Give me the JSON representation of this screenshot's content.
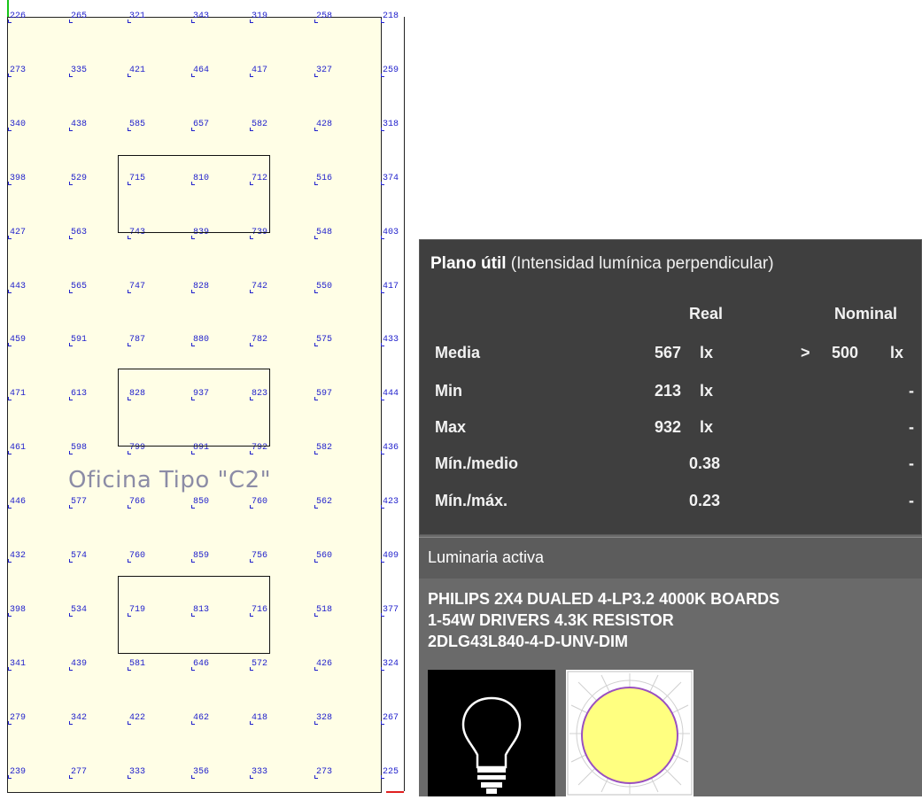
{
  "room": {
    "title": "Oficina Tipo \"C2\"",
    "grid": [
      [
        "226",
        "265",
        "321",
        "343",
        "319",
        "258",
        "218"
      ],
      [
        "273",
        "335",
        "421",
        "464",
        "417",
        "327",
        "259"
      ],
      [
        "340",
        "438",
        "585",
        "657",
        "582",
        "428",
        "318"
      ],
      [
        "398",
        "529",
        "715",
        "810",
        "712",
        "516",
        "374"
      ],
      [
        "427",
        "563",
        "743",
        "839",
        "739",
        "548",
        "403"
      ],
      [
        "443",
        "565",
        "747",
        "828",
        "742",
        "550",
        "417"
      ],
      [
        "459",
        "591",
        "787",
        "880",
        "782",
        "575",
        "433"
      ],
      [
        "471",
        "613",
        "828",
        "937",
        "823",
        "597",
        "444"
      ],
      [
        "461",
        "598",
        "799",
        "891",
        "792",
        "582",
        "436"
      ],
      [
        "446",
        "577",
        "766",
        "850",
        "760",
        "562",
        "423"
      ],
      [
        "432",
        "574",
        "760",
        "859",
        "756",
        "560",
        "409"
      ],
      [
        "398",
        "534",
        "719",
        "813",
        "716",
        "518",
        "377"
      ],
      [
        "341",
        "439",
        "581",
        "646",
        "572",
        "426",
        "324"
      ],
      [
        "279",
        "342",
        "422",
        "462",
        "418",
        "328",
        "267"
      ],
      [
        "239",
        "277",
        "333",
        "356",
        "333",
        "273",
        "225"
      ]
    ]
  },
  "results": {
    "title_bold": "Plano útil",
    "title_sub": "(Intensidad lumínica perpendicular)",
    "col_real": "Real",
    "col_nominal": "Nominal",
    "rows": [
      {
        "label": "Media",
        "real": "567",
        "real_unit": "lx",
        "cmp": ">",
        "nominal": "500",
        "nominal_unit": "lx"
      },
      {
        "label": "Min",
        "real": "213",
        "real_unit": "lx",
        "nominal": "-"
      },
      {
        "label": "Max",
        "real": "932",
        "real_unit": "lx",
        "nominal": "-"
      },
      {
        "label": "Mín./medio",
        "real": "0.38",
        "nominal": "-"
      },
      {
        "label": "Mín./máx.",
        "real": "0.23",
        "nominal": "-"
      }
    ]
  },
  "luminaire": {
    "section_label": "Luminaria activa",
    "name_lines": [
      "PHILIPS 2X4 DUALED 4-LP3.2 4000K BOARDS",
      "1-54W DRIVERS 4.3K RESISTOR",
      "2DLG43L840-4-D-UNV-DIM"
    ],
    "thumb_icons": [
      "light-bulb-icon",
      "light-distribution-icon"
    ]
  },
  "colors": {
    "plan_bg": "#fffee6",
    "value_text": "#2222cc",
    "panel_bg": "#3f3f3f"
  }
}
